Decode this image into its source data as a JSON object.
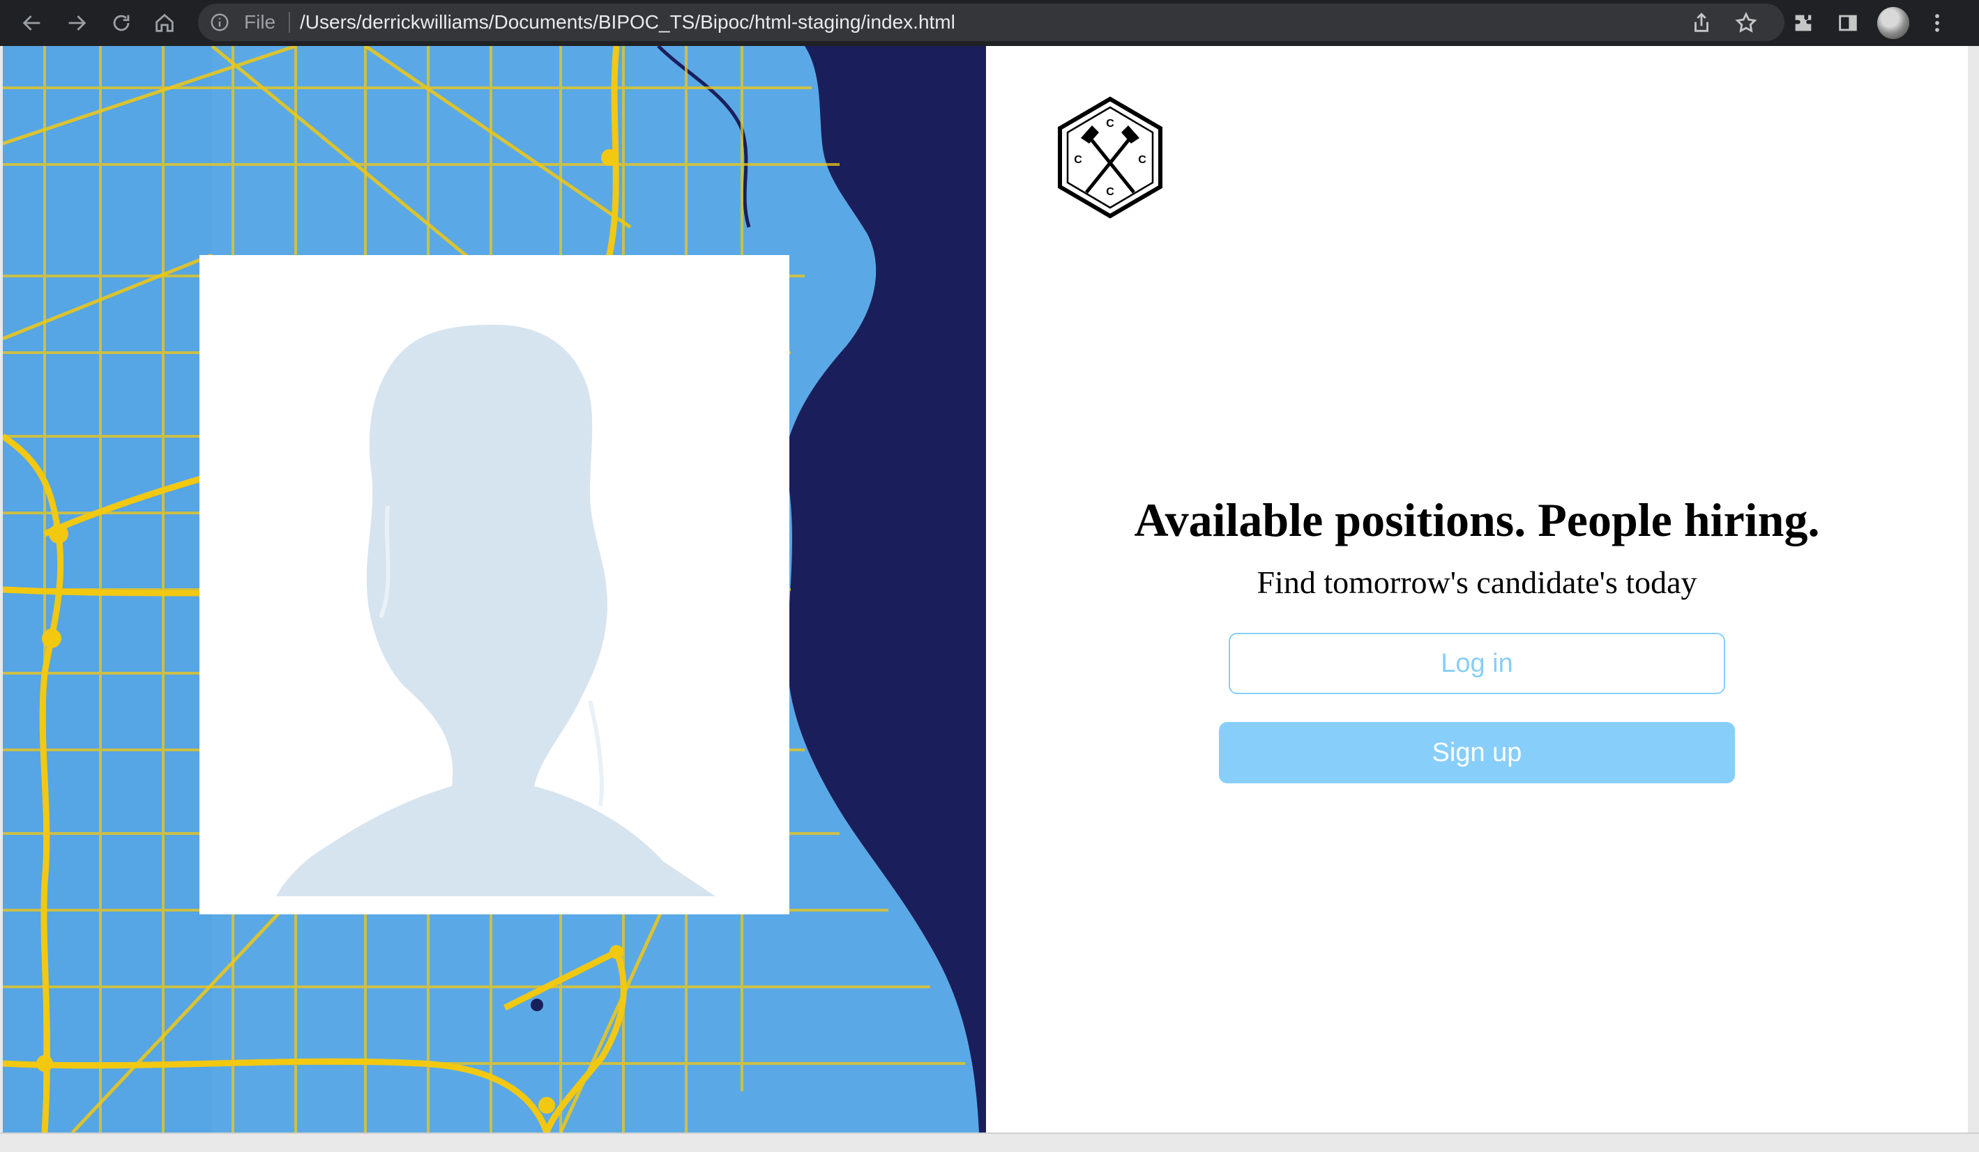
{
  "browser": {
    "omnibox_scheme": "File",
    "url": "/Users/derrickwilliams/Documents/BIPOC_TS/Bipoc/html-staging/index.html",
    "icons": [
      "back-icon",
      "forward-icon",
      "reload-icon",
      "home-icon",
      "info-icon",
      "share-icon",
      "bookmark-star-icon",
      "extensions-icon",
      "side-panel-icon",
      "profile-avatar",
      "menu-dots-icon"
    ]
  },
  "hero": {
    "headline": "Available positions. People hiring.",
    "subline": "Find tomorrow's candidate's today"
  },
  "auth": {
    "login_label": "Log in",
    "signup_label": "Sign up"
  },
  "logo": {
    "letters": [
      "C",
      "C",
      "C",
      "C"
    ]
  },
  "colors": {
    "accent": "#87cefa",
    "map_water": "#1a1f5c",
    "map_land": "#5aa9e6",
    "map_roads": "#f2c811",
    "silhouette": "#d6e4ef"
  }
}
